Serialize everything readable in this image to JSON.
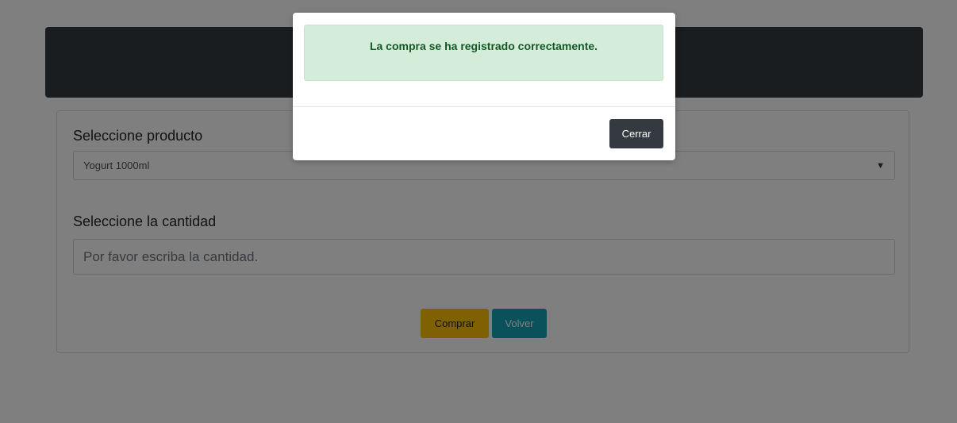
{
  "form": {
    "product_label": "Seleccione producto",
    "product_selected": "Yogurt 1000ml",
    "quantity_label": "Seleccione la cantidad",
    "quantity_placeholder": "Por favor escriba la cantidad.",
    "quantity_value": "",
    "buy_label": "Comprar",
    "back_label": "Volver"
  },
  "modal": {
    "message": "La compra se ha registrado correctamente.",
    "close_label": "Cerrar"
  },
  "icons": {
    "select_arrow": "chevron-down-icon"
  },
  "colors": {
    "header": "#343a40",
    "buy_button": "#ffc107",
    "back_button": "#17a2b8",
    "alert_bg": "#d4edda",
    "alert_text": "#155724",
    "close_button": "#343a40"
  }
}
